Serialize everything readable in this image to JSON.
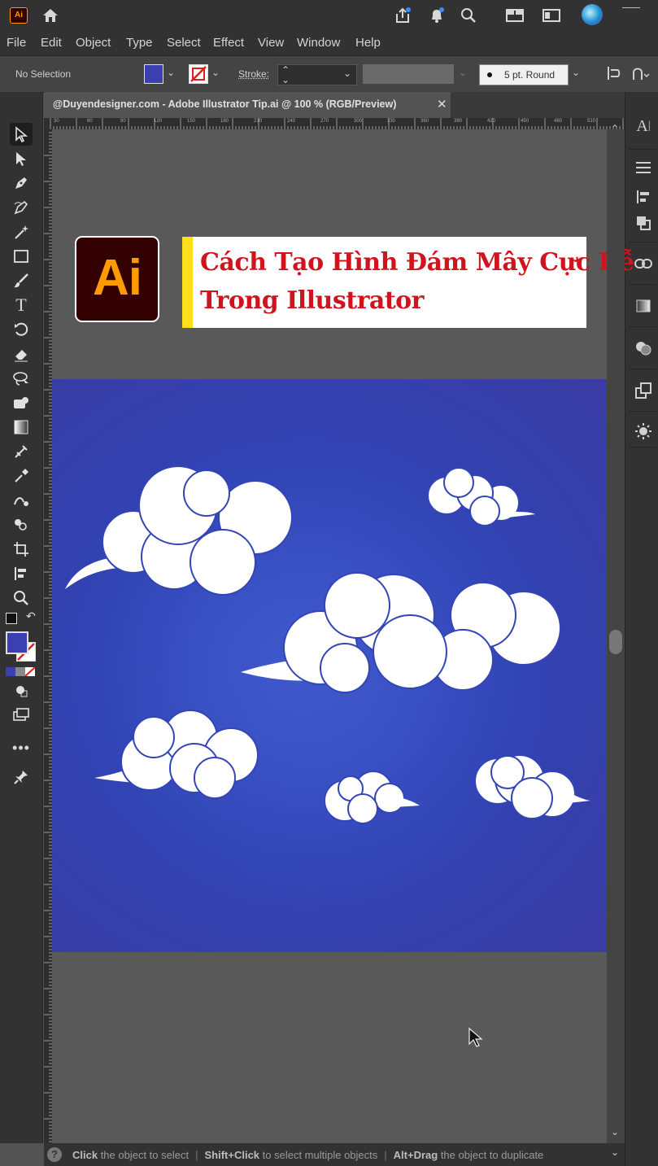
{
  "app": {
    "logo_text": "Ai"
  },
  "menu": [
    "File",
    "Edit",
    "Object",
    "Type",
    "Select",
    "Effect",
    "View",
    "Window",
    "Help"
  ],
  "control": {
    "selection": "No Selection",
    "stroke_label": "Stroke:",
    "brush": "5 pt. Round"
  },
  "document": {
    "tab_title": "@Duyendesigner.com - Adobe Illustrator Tip.ai @ 100 % (RGB/Preview)"
  },
  "ruler": {
    "ticks": [
      "30",
      "60",
      "90",
      "120",
      "150",
      "180",
      "210",
      "240",
      "270",
      "300",
      "330",
      "360",
      "390",
      "420",
      "450",
      "480",
      "510"
    ]
  },
  "banner": {
    "logo_text": "Ai",
    "line1": "Cách Tạo Hình Đám Mây Cực Dễ",
    "line2": "Trong Illustrator"
  },
  "status": {
    "hint1_key": "Click",
    "hint1_text": " the object to select",
    "hint2_key": "Shift+Click",
    "hint2_text": " to select multiple objects",
    "hint3_key": "Alt+Drag",
    "hint3_text": " the object to duplicate"
  },
  "colors": {
    "fill": "#3b3fb0",
    "artboard": "#3345b6",
    "banner_text": "#d0131c",
    "accent_bar": "#ffdf1a",
    "ai_orange": "#ff9a00",
    "ai_bg": "#330000"
  },
  "icons": [
    "home-icon",
    "share-icon",
    "bell-icon",
    "search-icon",
    "workspace-icon",
    "arrange-icon",
    "avatar"
  ]
}
